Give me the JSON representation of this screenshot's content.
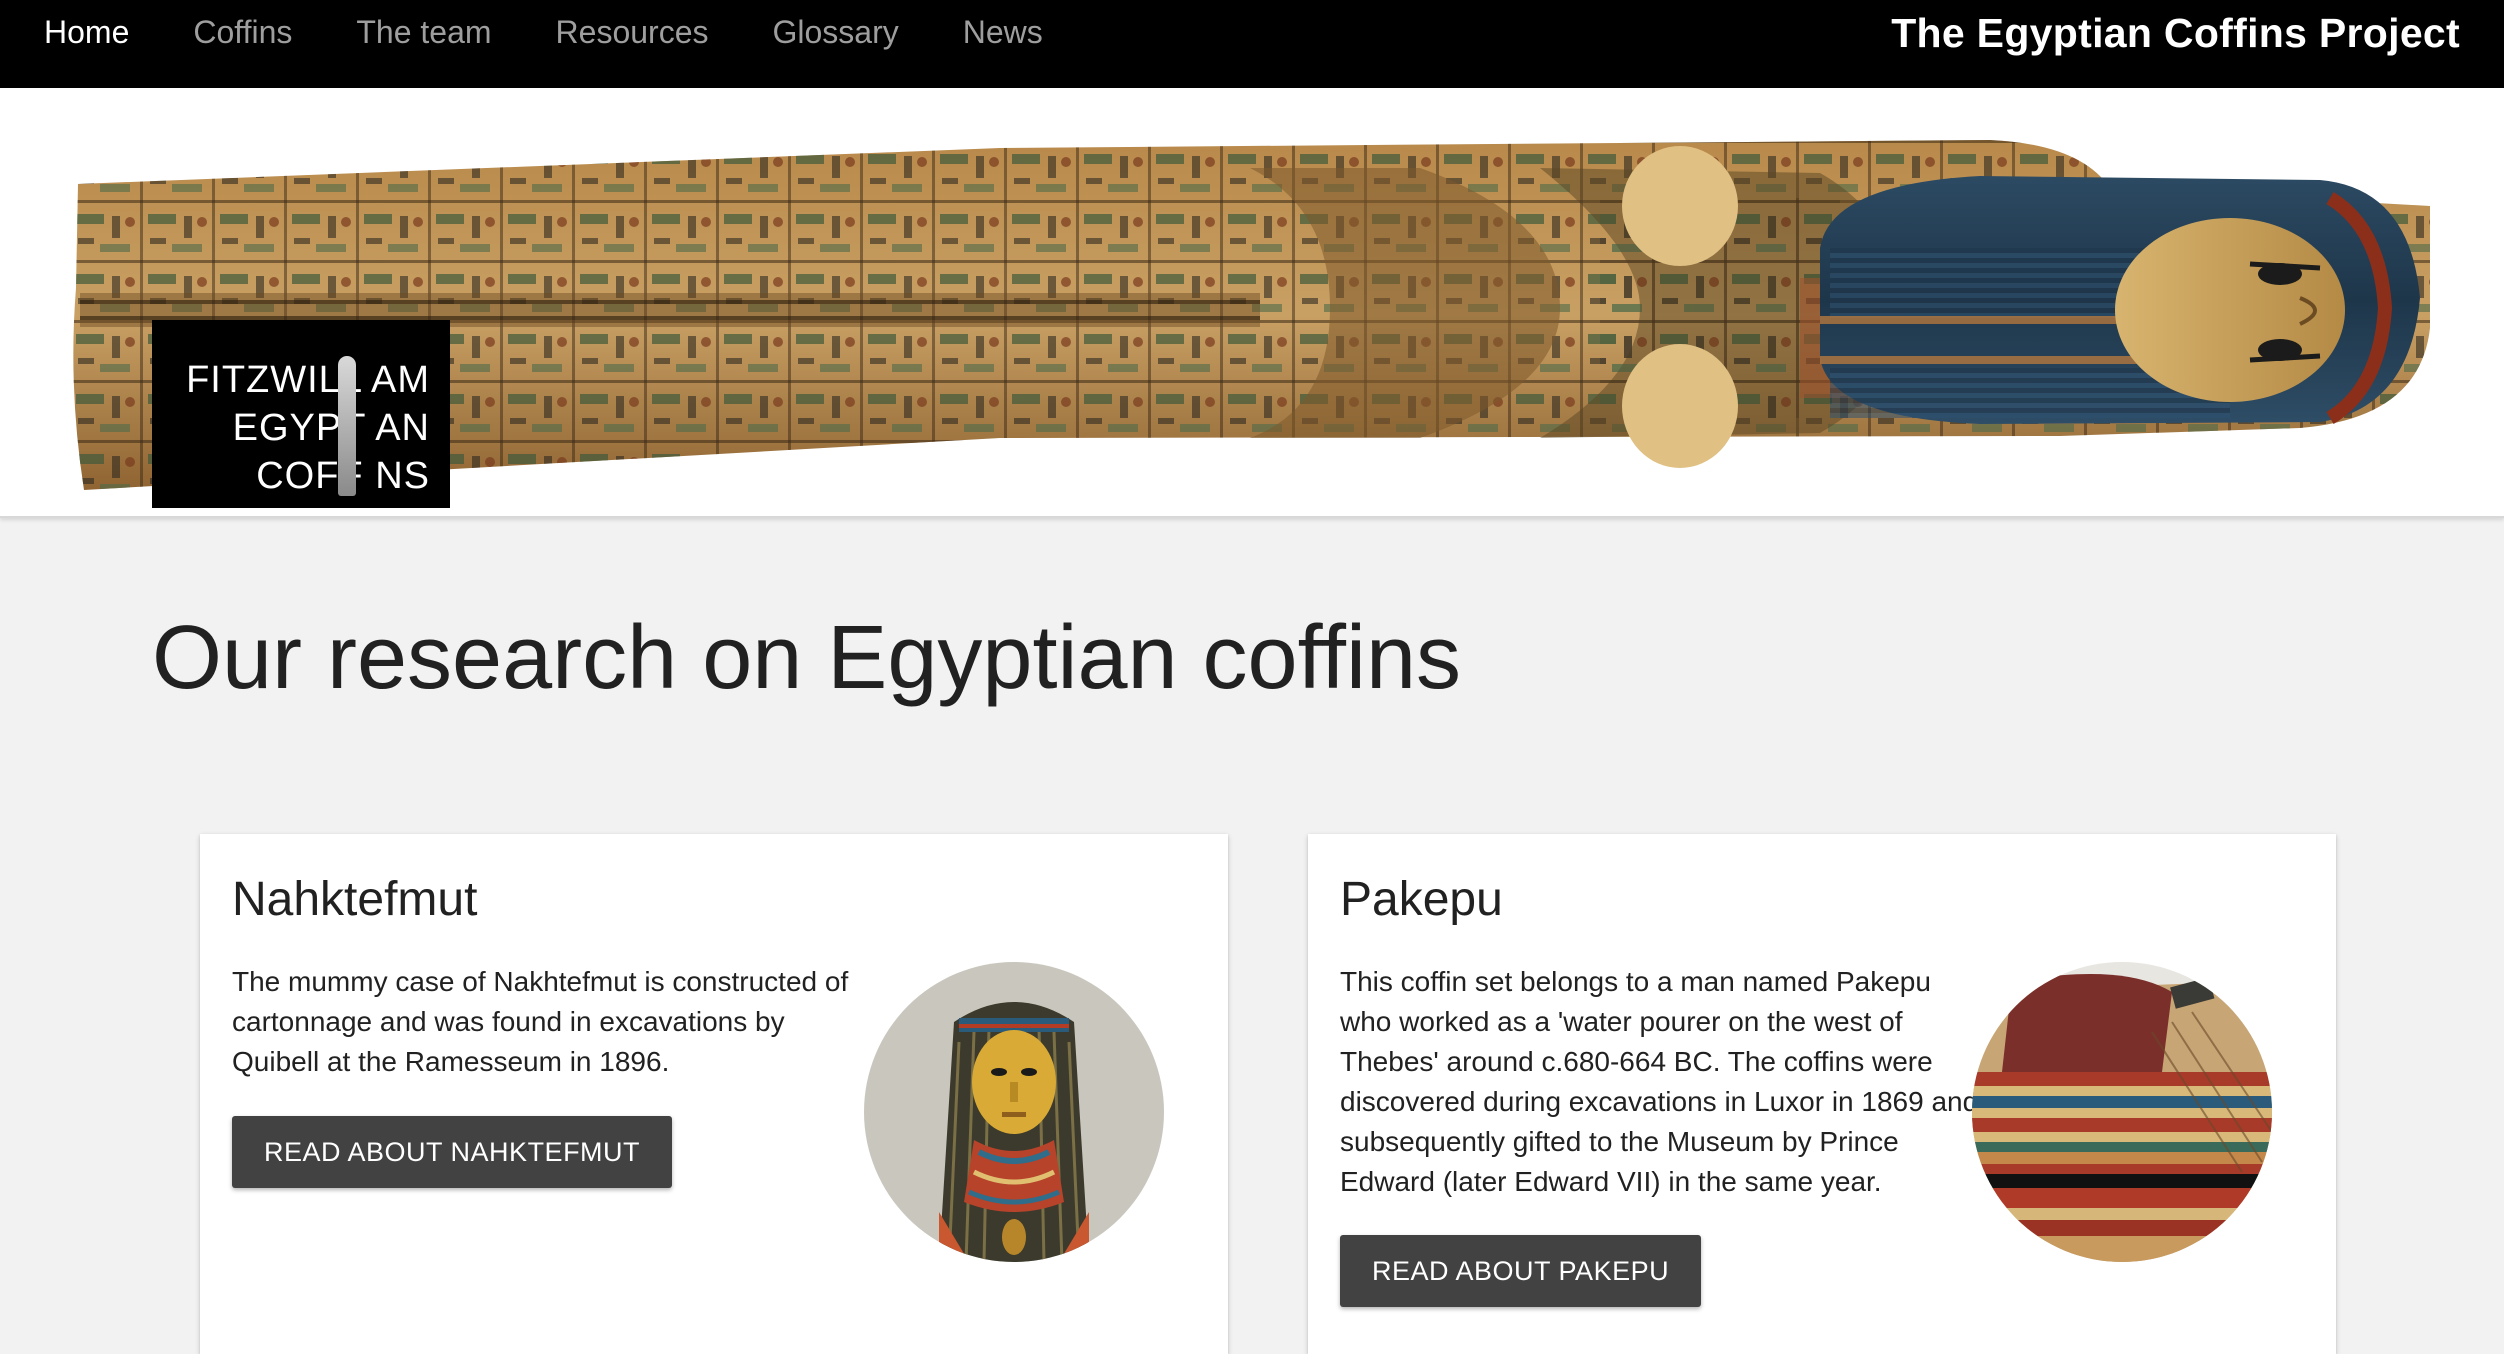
{
  "nav": {
    "items": [
      {
        "label": "Home",
        "active": true
      },
      {
        "label": "Coffins",
        "active": false
      },
      {
        "label": "The team",
        "active": false
      },
      {
        "label": "Resources",
        "active": false
      },
      {
        "label": "Glossary",
        "active": false
      },
      {
        "label": "News",
        "active": false
      }
    ],
    "site_title": "The Egyptian Coffins Project"
  },
  "banner": {
    "image": "painted-coffin-lid-image",
    "logo": {
      "lines": [
        "FITZWILLIAM",
        "EGYPTIAN",
        "COFFINS"
      ],
      "rendered_lines": [
        "FITZWILL  AM",
        "EGYPT  AN",
        "COFF  NS"
      ]
    }
  },
  "main": {
    "heading": "Our research on Egyptian coffins",
    "cards": [
      {
        "title": "Nahktefmut",
        "text": "The mummy case of Nakhtefmut is constructed of cartonnage and was found in excavations by Quibell at the Ramesseum in 1896.",
        "button": "READ ABOUT NAHKTEFMUT",
        "thumbnail": "nakhtefmut-mummy-case-photo"
      },
      {
        "title": "Pakepu",
        "text": "This coffin set belongs to a man named Pakepu who worked as a 'water pourer on the west of Thebes' around c.680-664 BC. The coffins were discovered during excavations in Luxor in 1869 and subsequently gifted to the Museum by Prince Edward (later Edward VII) in the same year.",
        "button": "READ ABOUT PAKEPU",
        "thumbnail": "pakepu-coffin-photo"
      }
    ]
  },
  "colors": {
    "navbar_bg": "#000000",
    "nav_active": "#ffffff",
    "nav_inactive": "#9e9e9e",
    "page_bg": "#f2f2f2",
    "button_bg": "#424242"
  }
}
